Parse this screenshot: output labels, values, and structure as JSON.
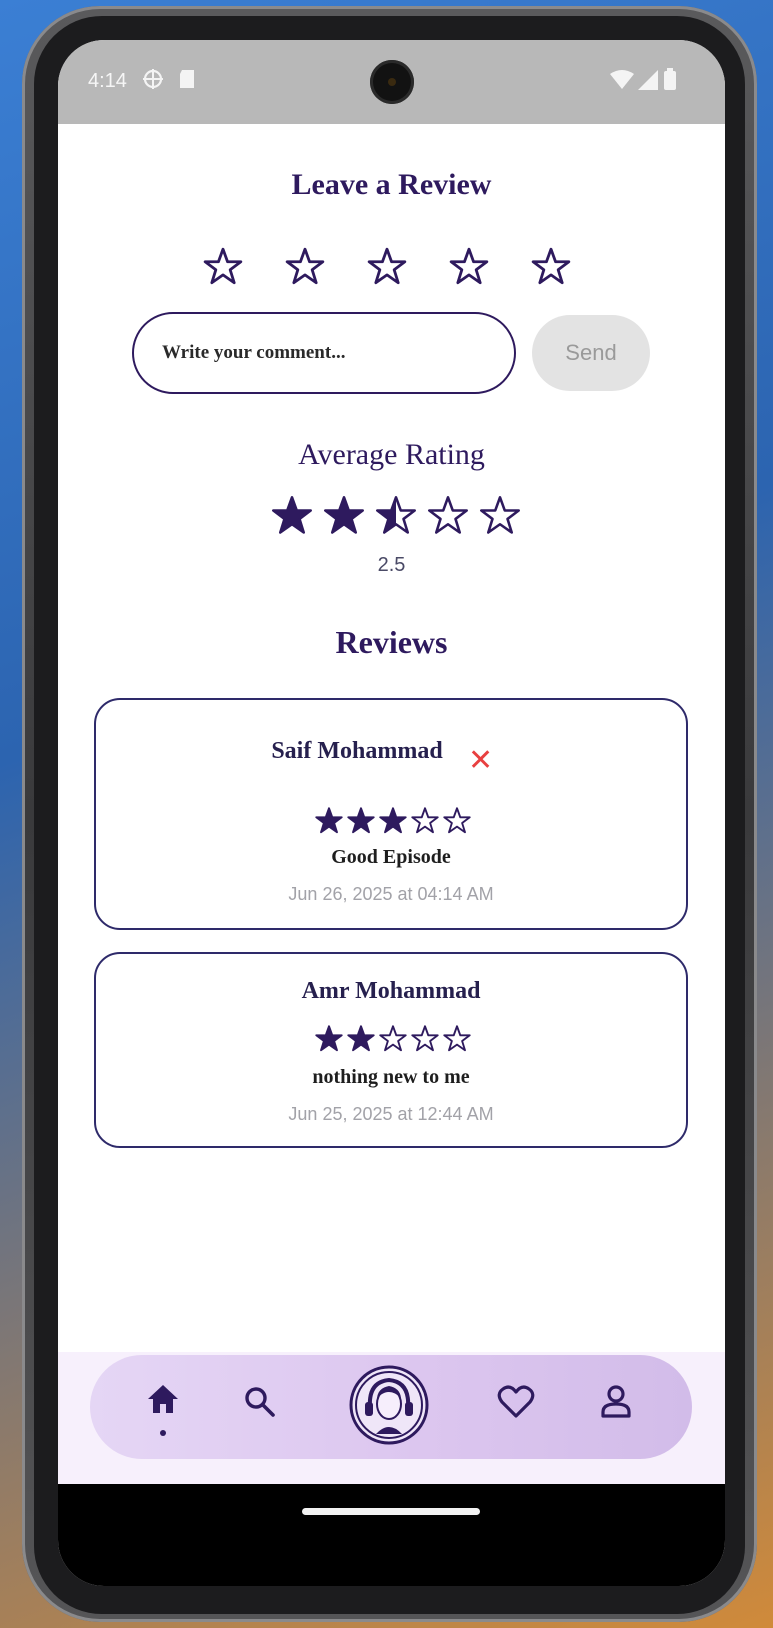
{
  "status_bar": {
    "time": "4:14",
    "icons": [
      "location-icon",
      "sd-card-icon",
      "wifi-icon",
      "signal-icon",
      "battery-icon"
    ]
  },
  "leave_review": {
    "title": "Leave a Review",
    "stars_selected": 0,
    "stars_total": 5,
    "comment_placeholder": "Write your comment...",
    "send_label": "Send"
  },
  "average": {
    "title": "Average Rating",
    "value": 2.5,
    "value_text": "2.5"
  },
  "reviews": {
    "title": "Reviews",
    "items": [
      {
        "name": "Saif Mohammad",
        "rating": 3,
        "comment": "Good Episode",
        "date": "Jun 26, 2025 at 04:14 AM",
        "deletable": true
      },
      {
        "name": "Amr Mohammad",
        "rating": 2,
        "comment": "nothing new to me",
        "date": "Jun 25, 2025 at 12:44 AM",
        "deletable": false
      }
    ]
  },
  "nav": {
    "items": [
      "home-icon",
      "search-icon",
      "podcast-avatar-icon",
      "heart-icon",
      "profile-icon"
    ],
    "active": "home-icon"
  },
  "colors": {
    "primary": "#2e1a5e",
    "delete": "#e84040",
    "nav_bg": "#dcc6ef"
  }
}
